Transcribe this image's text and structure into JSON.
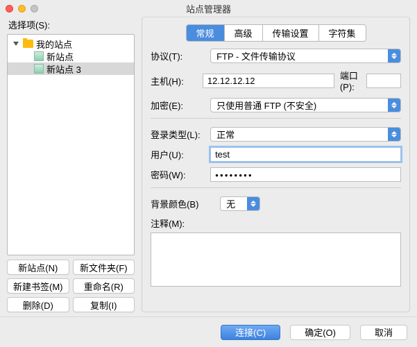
{
  "window": {
    "title": "站点管理器"
  },
  "left": {
    "label": "选择项(S):",
    "tree": {
      "root_label": "我的站点",
      "items": [
        "新站点",
        "新站点 3"
      ]
    },
    "buttons": [
      "新站点(N)",
      "新文件夹(F)",
      "新建书签(M)",
      "重命名(R)",
      "删除(D)",
      "复制(I)"
    ]
  },
  "tabs": [
    "常规",
    "高级",
    "传输设置",
    "字符集"
  ],
  "form": {
    "protocol_label": "协议(T):",
    "protocol_value": "FTP - 文件传输协议",
    "host_label": "主机(H):",
    "host_value": "12.12.12.12",
    "port_label": "端口(P):",
    "port_value": "",
    "encryption_label": "加密(E):",
    "encryption_value": "只使用普通 FTP (不安全)",
    "logon_label": "登录类型(L):",
    "logon_value": "正常",
    "user_label": "用户(U):",
    "user_value": "test",
    "password_label": "密码(W):",
    "password_mask": "●●●●●●●●",
    "bgcolor_label": "背景颜色(B)",
    "bgcolor_value": "无",
    "comment_label": "注释(M):"
  },
  "footer": {
    "connect": "连接(C)",
    "ok": "确定(O)",
    "cancel": "取消"
  }
}
